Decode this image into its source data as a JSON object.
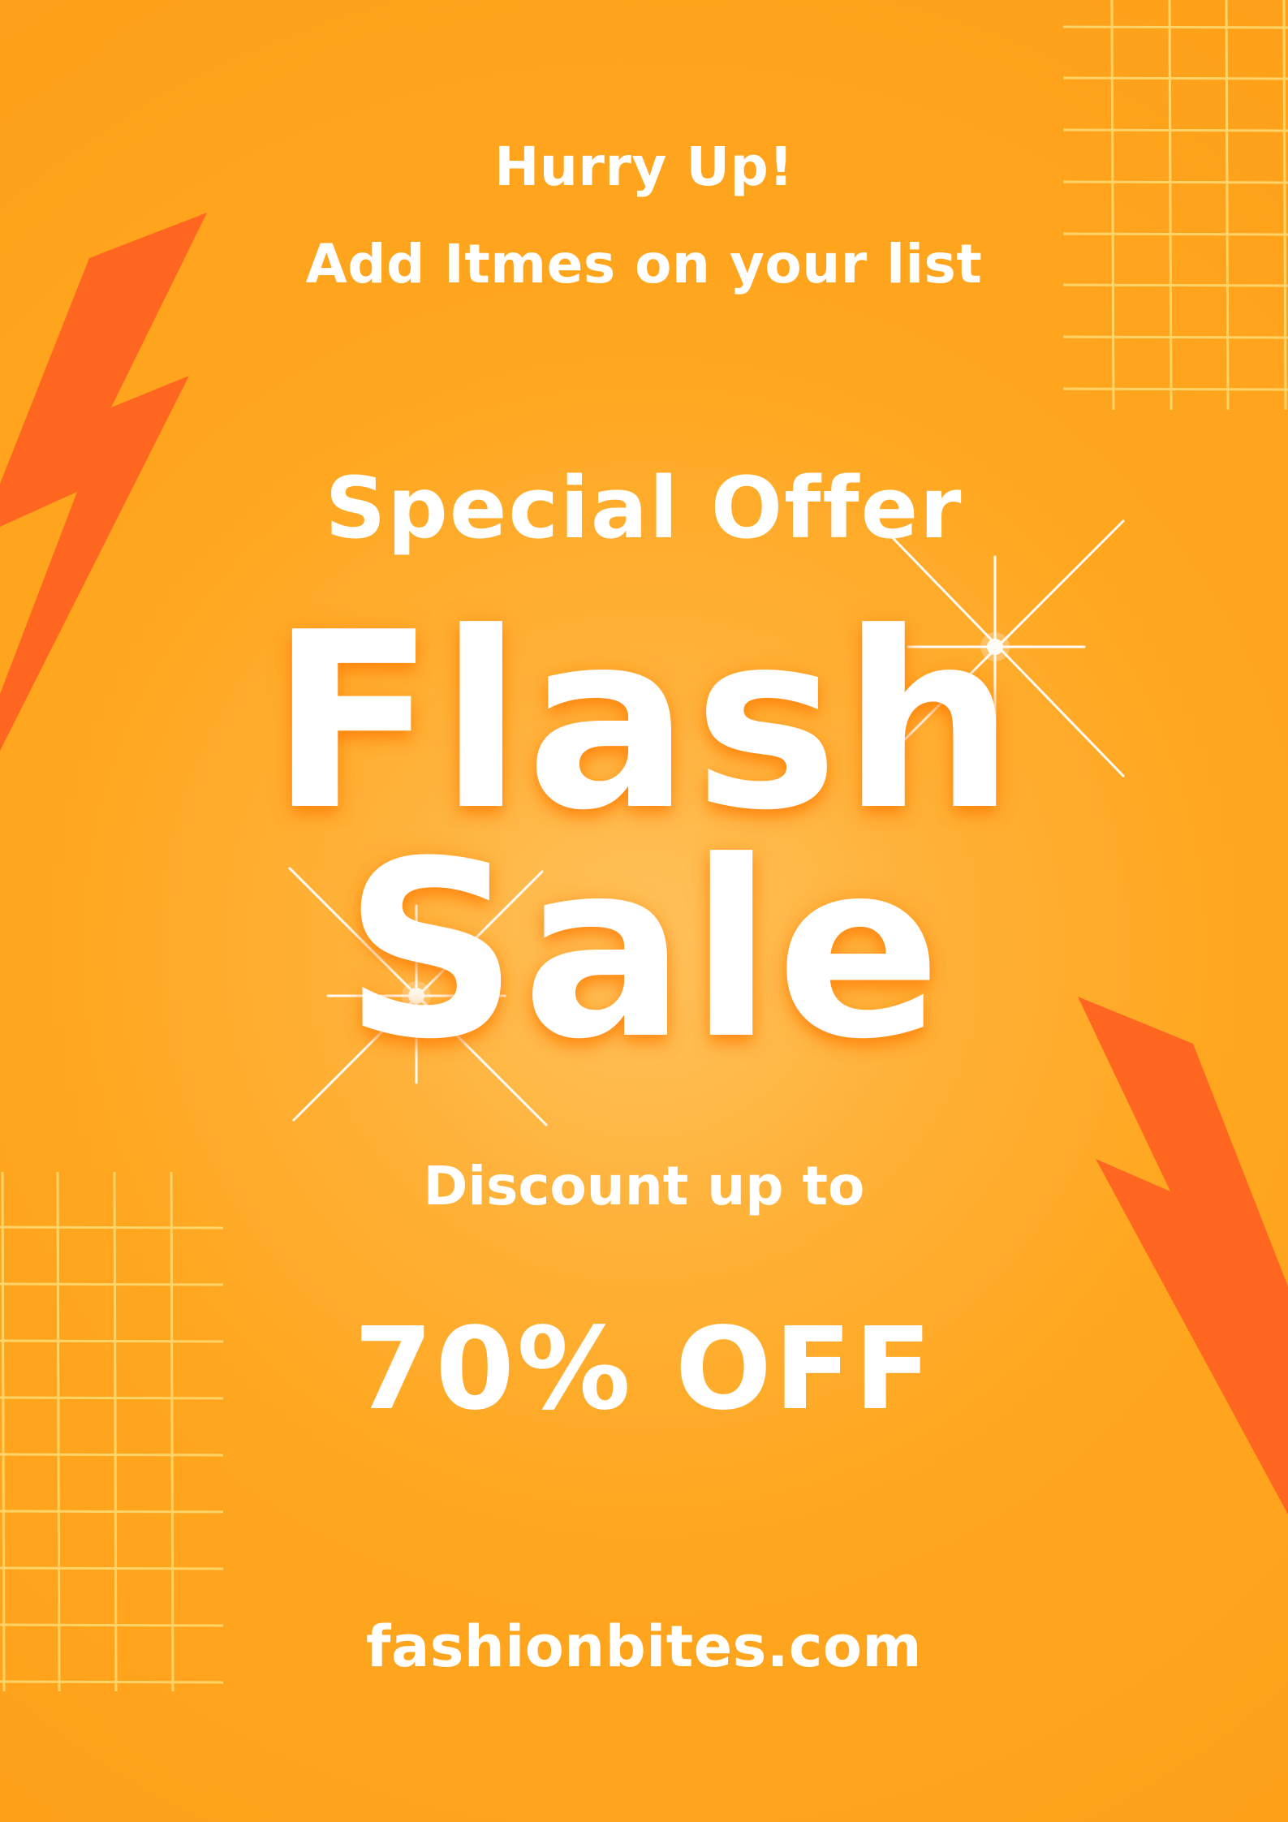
{
  "poster": {
    "line1": "Hurry Up!",
    "line2": "Add Itmes on your list",
    "special_offer": "Special Offer",
    "headline_word1": "Flash",
    "headline_word2": "Sale",
    "discount_text": "Discount up to",
    "discount_value": "70% OFF",
    "website": "fashionbites.com"
  },
  "colors": {
    "background": "#ffa61e",
    "background_glow": "#ffc35e",
    "bolt": "#ff661f",
    "grid_lines": "#ffd76b",
    "text": "#ffffff"
  },
  "icons": {
    "left_bolt": "lightning-bolt-icon",
    "right_bolt": "lightning-bolt-icon",
    "sparkles": "sparkle-icon"
  }
}
